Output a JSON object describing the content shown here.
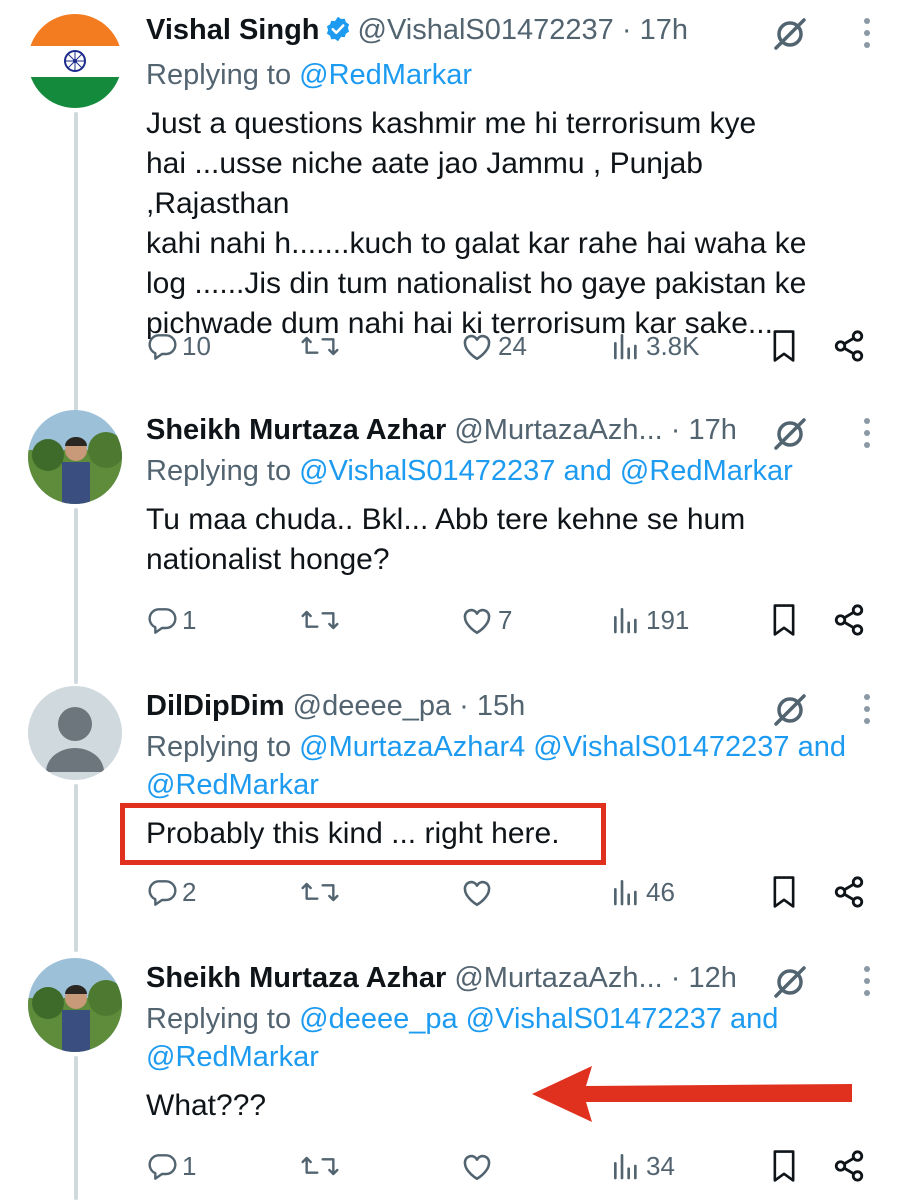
{
  "tweets": [
    {
      "name": "Vishal Singh",
      "verified": true,
      "handle": "@VishalS01472237",
      "time": "17h",
      "replying_prefix": "Replying to ",
      "replying_to": "@RedMarkar",
      "text_lines": [
        "Just a questions kashmir me hi terrorisum kye",
        "hai ...usse niche aate jao Jammu , Punjab ,Rajasthan",
        "kahi nahi h.......kuch to galat kar rahe hai waha ke",
        "log ......Jis din tum nationalist ho gaye pakistan ke",
        "pichwade dum nahi hai ki terrorisum kar sake..."
      ],
      "replies": "10",
      "retweets": "",
      "likes": "24",
      "views": "3.8K",
      "avatar": "india-flag"
    },
    {
      "name": "Sheikh Murtaza Azhar",
      "handle": "@MurtazaAzh...",
      "time": "17h",
      "replying_prefix": "Replying to ",
      "replying_line1": "@VishalS01472237 and @RedMarkar",
      "text_lines": [
        "Tu maa chuda.. Bkl... Abb tere kehne se hum",
        "nationalist honge?"
      ],
      "replies": "1",
      "retweets": "",
      "likes": "7",
      "views": "191",
      "avatar": "photo-person"
    },
    {
      "name": "DilDipDim",
      "handle": "@deeee_pa",
      "time": "15h",
      "replying_prefix": "Replying to ",
      "replying_line1": "@MurtazaAzhar4 @VishalS01472237 and",
      "replying_line2": "@RedMarkar",
      "text_lines": [
        "Probably this kind ... right here."
      ],
      "replies": "2",
      "retweets": "",
      "likes": "",
      "views": "46",
      "avatar": "default-avatar"
    },
    {
      "name": "Sheikh Murtaza Azhar",
      "handle": "@MurtazaAzh...",
      "time": "12h",
      "replying_prefix": "Replying to ",
      "replying_line1": "@deeee_pa @VishalS01472237 and",
      "replying_line2": "@RedMarkar",
      "text_lines": [
        "What???"
      ],
      "replies": "1",
      "retweets": "",
      "likes": "",
      "views": "34",
      "avatar": "photo-person"
    }
  ],
  "separator": "·",
  "colors": {
    "link": "#1d9bf0",
    "muted": "#536471",
    "annotation_red": "#e0301e",
    "thread_line": "#cfd9de"
  }
}
